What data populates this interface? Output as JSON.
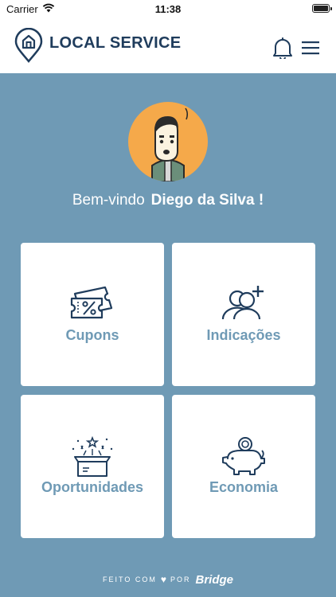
{
  "status_bar": {
    "carrier": "Carrier",
    "time": "11:38"
  },
  "header": {
    "title": "LOCAL SERVICE",
    "icons": [
      "location-home-logo-icon",
      "bell-icon",
      "menu-icon"
    ]
  },
  "profile": {
    "greeting": "Bem-vindo",
    "user_name": "Diego da Silva !",
    "avatar_color": "#f5a94a"
  },
  "menu": {
    "cards": [
      {
        "label": "Cupons",
        "icon": "coupon-icon"
      },
      {
        "label": "Indicações",
        "icon": "add-user-icon"
      },
      {
        "label": "Oportunidades",
        "icon": "gift-box-icon"
      },
      {
        "label": "Economia",
        "icon": "piggy-bank-icon"
      }
    ]
  },
  "footer": {
    "made_with": "FEITO COM",
    "by": "POR",
    "brand": "Bridge"
  },
  "colors": {
    "background": "#6f9ab5",
    "primary": "#1f3c5c",
    "card": "#ffffff"
  }
}
